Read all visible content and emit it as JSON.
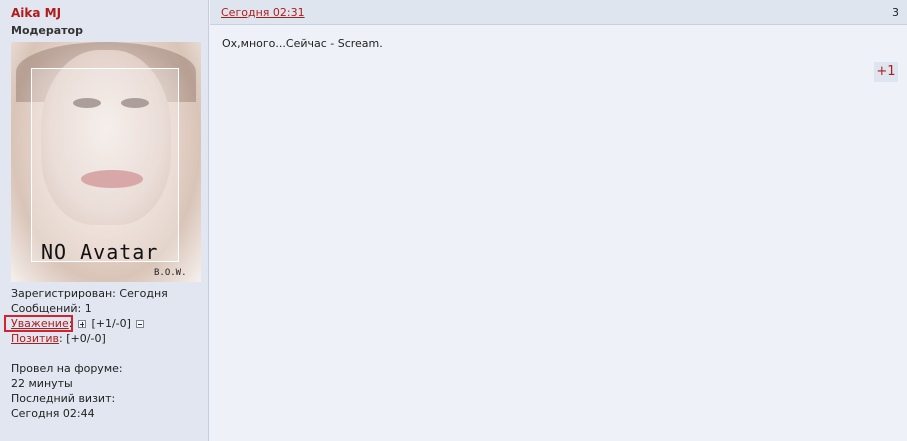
{
  "user": {
    "name": "Aika MJ",
    "title": "Модератор",
    "avatar_text": "NO Avatar",
    "avatar_signature": "B.O.W.",
    "registered": "Зарегистрирован: Сегодня",
    "messages": "Сообщений: 1",
    "respect_label": "Уважение",
    "respect_suffix": ":",
    "respect_value": "[+1/-0]",
    "positive_label": "Позитив",
    "positive_suffix": ":",
    "positive_value": "[+0/-0]",
    "time_on_forum_label": "Провел на форуме:",
    "time_on_forum_value": "22 минуты",
    "last_visit_label": "Последний визит:",
    "last_visit_value": "Сегодня 02:44"
  },
  "post": {
    "date": "Сегодня 02:31",
    "number": "3",
    "body": "Ох,много...Сейчас - Scream.",
    "plus_button": "+1"
  },
  "colors": {
    "link_red": "#b01c1c",
    "highlight_border": "#d4232f",
    "sidebar_bg": "#e1e6f0",
    "main_bg": "#eef2f8"
  }
}
